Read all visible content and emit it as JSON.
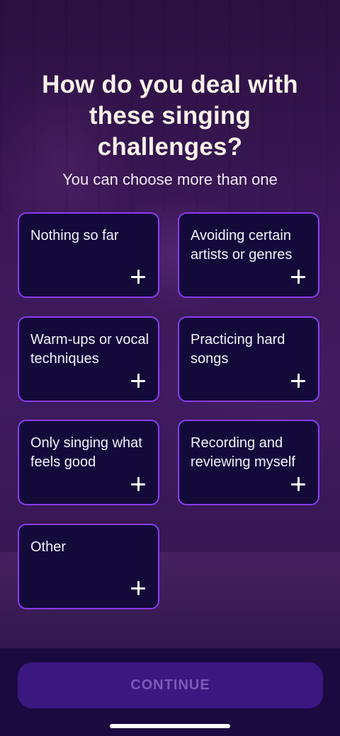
{
  "header": {
    "title": "How do you deal with these singing challenges?",
    "subtitle": "You can choose more than one"
  },
  "options": [
    {
      "label": "Nothing so far",
      "icon": "plus-icon"
    },
    {
      "label": "Avoiding certain artists or genres",
      "icon": "plus-icon"
    },
    {
      "label": "Warm-ups or vocal techniques",
      "icon": "plus-icon"
    },
    {
      "label": "Practicing hard songs",
      "icon": "plus-icon"
    },
    {
      "label": "Only singing what feels good",
      "icon": "plus-icon"
    },
    {
      "label": "Recording and reviewing myself",
      "icon": "plus-icon"
    },
    {
      "label": "Other",
      "icon": "plus-icon"
    }
  ],
  "footer": {
    "continue_label": "CONTINUE"
  },
  "colors": {
    "card_background": "#130a3a",
    "card_border": "#8a3cf0",
    "button_background": "#3b1780",
    "button_text": "#7a5bb8",
    "title_text": "#faf3e8"
  }
}
